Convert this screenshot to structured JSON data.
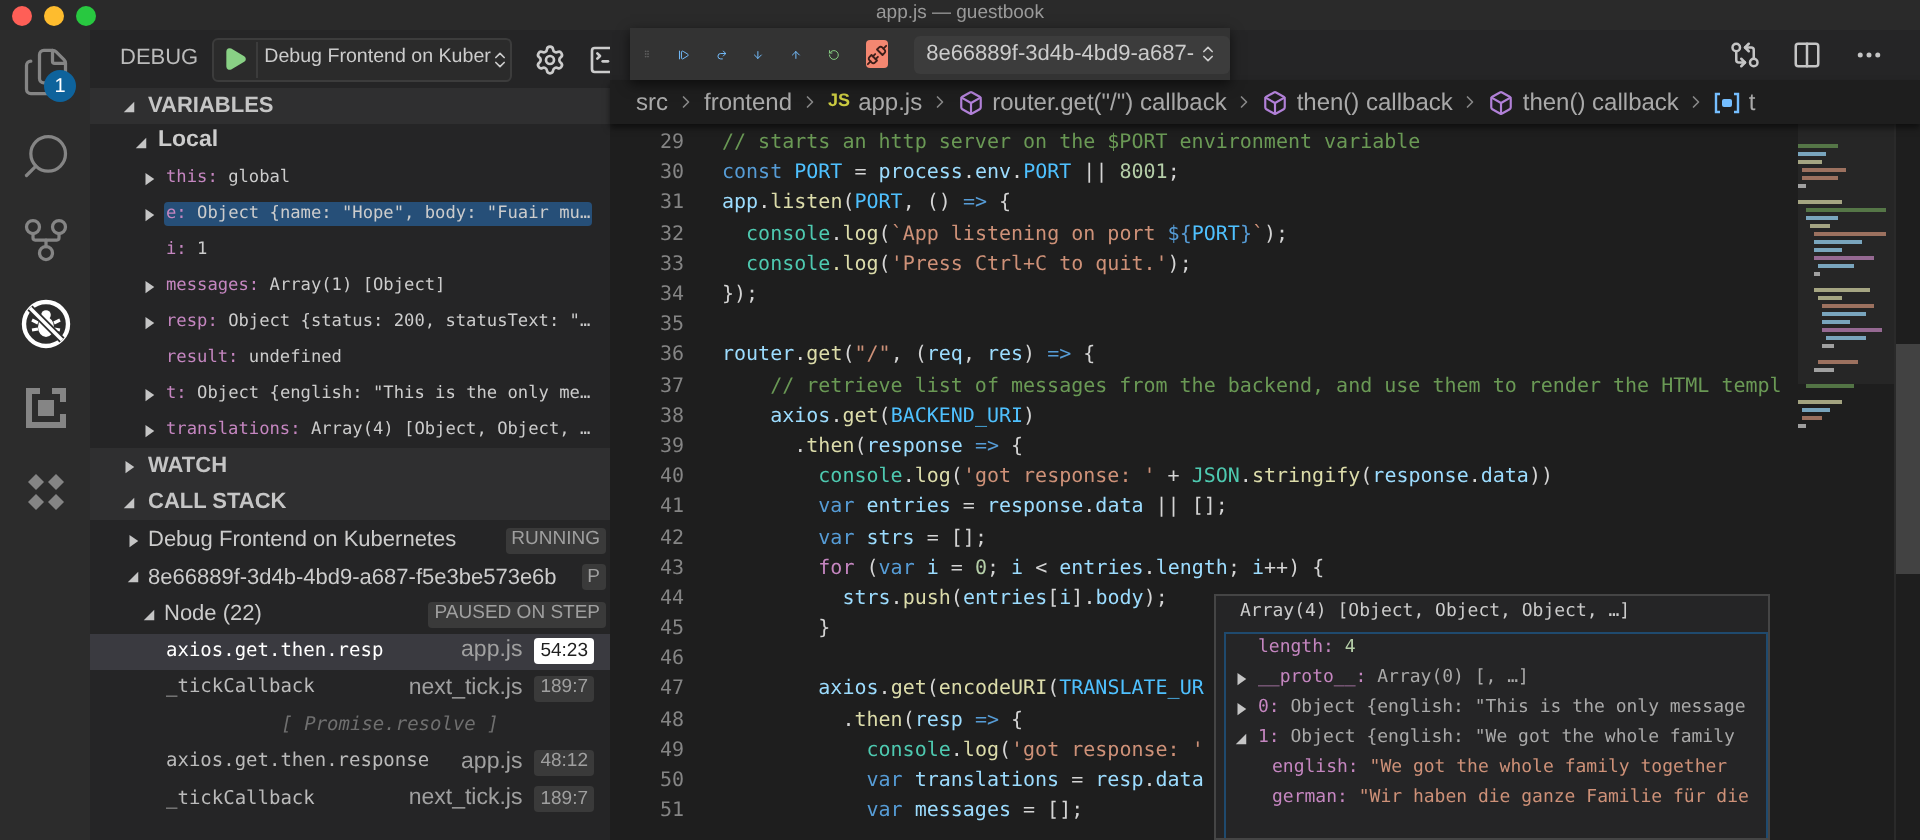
{
  "window": {
    "title": "app.js — guestbook"
  },
  "activity_bar": {
    "items": [
      {
        "kind": "files",
        "selected": false,
        "badge": "1"
      },
      {
        "kind": "search",
        "selected": false
      },
      {
        "kind": "source-control",
        "selected": false
      },
      {
        "kind": "debug",
        "selected": true
      },
      {
        "kind": "extensions",
        "selected": false
      },
      {
        "kind": "kubernetes",
        "selected": false
      }
    ]
  },
  "sidebar": {
    "title": "DEBUG",
    "configuration": "Debug Frontend on Kuber",
    "sections": [
      {
        "kind": "variables",
        "title": "VARIABLES",
        "expanded": true,
        "scopes": [
          {
            "name": "Local",
            "expanded": true,
            "children": [
              {
                "kind": "node",
                "name": "this:",
                "value": "global",
                "expanded": false,
                "selected": false
              },
              {
                "kind": "node",
                "name": "e:",
                "value": "Object {name: \"Hope\", body: \"Fuair mu…",
                "expanded": false,
                "selected": true
              },
              {
                "kind": "leaf",
                "name": "i:",
                "value": "1",
                "selected": false
              },
              {
                "kind": "node",
                "name": "messages:",
                "value": "Array(1) [Object]",
                "expanded": false,
                "selected": false
              },
              {
                "kind": "node",
                "name": "resp:",
                "value": "Object {status: 200, statusText: \"…",
                "expanded": false,
                "selected": false
              },
              {
                "kind": "leaf",
                "name": "result:",
                "value": "undefined",
                "selected": false
              },
              {
                "kind": "node",
                "name": "t:",
                "value": "Object {english: \"This is the only me…",
                "expanded": false,
                "selected": false
              },
              {
                "kind": "node",
                "name": "translations:",
                "value": "Array(4) [Object, Object, …",
                "expanded": false,
                "selected": false
              }
            ]
          }
        ]
      },
      {
        "kind": "watch",
        "title": "WATCH",
        "expanded": false
      },
      {
        "kind": "call-stack",
        "title": "CALL STACK",
        "expanded": true,
        "children": [
          {
            "kind": "session",
            "label": "Debug Frontend on Kubernetes",
            "badge": "RUNNING",
            "expanded": false
          },
          {
            "kind": "session",
            "label": "8e66889f-3d4b-4bd9-a687-f5e3be573e6b",
            "badge": "P",
            "expanded": true,
            "children": [
              {
                "kind": "thread",
                "label": "Node (22)",
                "badge": "PAUSED ON STEP",
                "expanded": true,
                "children": [
                  {
                    "kind": "frame",
                    "name": "axios.get.then.resp",
                    "file": "app.js",
                    "position": "54:23",
                    "selected": true
                  },
                  {
                    "kind": "frame",
                    "name": "_tickCallback",
                    "file": "next_tick.js",
                    "position": "189:7",
                    "selected": false
                  },
                  {
                    "kind": "label",
                    "name": "[ Promise.resolve ]"
                  },
                  {
                    "kind": "frame",
                    "name": "axios.get.then.response",
                    "file": "app.js",
                    "position": "48:12",
                    "selected": false
                  },
                  {
                    "kind": "frame",
                    "name": "_tickCallback",
                    "file": "next_tick.js",
                    "position": "189:7",
                    "selected": false
                  }
                ]
              }
            ]
          }
        ]
      }
    ]
  },
  "debug_toolbar": {
    "buttons": [
      {
        "kind": "continue"
      },
      {
        "kind": "step-over"
      },
      {
        "kind": "step-into"
      },
      {
        "kind": "step-out"
      },
      {
        "kind": "restart"
      },
      {
        "kind": "disconnect"
      }
    ],
    "thread": "8e66889f-3d4b-4bd9-a687-"
  },
  "breadcrumb": [
    {
      "kind": "folder",
      "label": "src"
    },
    {
      "kind": "folder",
      "label": "frontend"
    },
    {
      "kind": "file",
      "badge": "JS",
      "label": "app.js"
    },
    {
      "kind": "symbol",
      "label": "router.get(\"/\") callback"
    },
    {
      "kind": "symbol",
      "label": "then() callback"
    },
    {
      "kind": "symbol",
      "label": "then() callback"
    },
    {
      "kind": "variable",
      "label": "t"
    }
  ],
  "editor": {
    "lines": [
      {
        "number": "29",
        "tokens": [
          {
            "kind": "comment",
            "text": "// starts an http server on the $PORT environment variable"
          }
        ]
      },
      {
        "number": "30",
        "tokens": [
          {
            "kind": "kw",
            "text": "const "
          },
          {
            "kind": "const",
            "text": "PORT"
          },
          {
            "kind": "p",
            "text": " = "
          },
          {
            "kind": "var",
            "text": "process"
          },
          {
            "kind": "p",
            "text": "."
          },
          {
            "kind": "var",
            "text": "env"
          },
          {
            "kind": "p",
            "text": "."
          },
          {
            "kind": "const",
            "text": "PORT"
          },
          {
            "kind": "p",
            "text": " || "
          },
          {
            "kind": "num",
            "text": "8001"
          },
          {
            "kind": "p",
            "text": ";"
          }
        ]
      },
      {
        "number": "31",
        "tokens": [
          {
            "kind": "var",
            "text": "app"
          },
          {
            "kind": "p",
            "text": "."
          },
          {
            "kind": "fn",
            "text": "listen"
          },
          {
            "kind": "p",
            "text": "("
          },
          {
            "kind": "const",
            "text": "PORT"
          },
          {
            "kind": "p",
            "text": ", () "
          },
          {
            "kind": "kw",
            "text": "=>"
          },
          {
            "kind": "p",
            "text": " {"
          }
        ]
      },
      {
        "number": "32",
        "tokens": [
          {
            "kind": "type",
            "text": "  console"
          },
          {
            "kind": "p",
            "text": "."
          },
          {
            "kind": "fn",
            "text": "log"
          },
          {
            "kind": "p",
            "text": "("
          },
          {
            "kind": "str",
            "text": "`App listening on port "
          },
          {
            "kind": "kw",
            "text": "${"
          },
          {
            "kind": "const",
            "text": "PORT"
          },
          {
            "kind": "kw",
            "text": "}"
          },
          {
            "kind": "str",
            "text": "`"
          },
          {
            "kind": "p",
            "text": ");"
          }
        ]
      },
      {
        "number": "33",
        "tokens": [
          {
            "kind": "type",
            "text": "  console"
          },
          {
            "kind": "fn",
            "text": ".log"
          },
          {
            "kind": "p",
            "text": "("
          },
          {
            "kind": "str",
            "text": "'Press Ctrl+C to quit.'"
          },
          {
            "kind": "p",
            "text": ");"
          }
        ]
      },
      {
        "number": "34",
        "tokens": [
          {
            "kind": "p",
            "text": "});"
          }
        ]
      },
      {
        "number": "35"
      },
      {
        "number": "36",
        "tokens": [
          {
            "kind": "var",
            "text": "router"
          },
          {
            "kind": "p",
            "text": "."
          },
          {
            "kind": "fn",
            "text": "get"
          },
          {
            "kind": "p",
            "text": "("
          },
          {
            "kind": "str",
            "text": "\"/\""
          },
          {
            "kind": "p",
            "text": ", ("
          },
          {
            "kind": "var",
            "text": "req"
          },
          {
            "kind": "p",
            "text": ", "
          },
          {
            "kind": "var",
            "text": "res"
          },
          {
            "kind": "p",
            "text": ") "
          },
          {
            "kind": "kw",
            "text": "=>"
          },
          {
            "kind": "p",
            "text": " {"
          }
        ]
      },
      {
        "number": "37",
        "tokens": [
          {
            "kind": "comment",
            "text": "    // retrieve list of messages from the backend, and use them to render the HTML templ"
          }
        ]
      },
      {
        "number": "38",
        "tokens": [
          {
            "kind": "var",
            "text": "    axios"
          },
          {
            "kind": "p",
            "text": "."
          },
          {
            "kind": "fn",
            "text": "get"
          },
          {
            "kind": "p",
            "text": "("
          },
          {
            "kind": "const",
            "text": "BACKEND_URI"
          },
          {
            "kind": "p",
            "text": ")"
          }
        ]
      },
      {
        "number": "39",
        "tokens": [
          {
            "kind": "p",
            "text": "      ."
          },
          {
            "kind": "fn",
            "text": "then"
          },
          {
            "kind": "p",
            "text": "("
          },
          {
            "kind": "var",
            "text": "response "
          },
          {
            "kind": "kw",
            "text": "=>"
          },
          {
            "kind": "p",
            "text": " {"
          }
        ]
      },
      {
        "number": "40",
        "tokens": [
          {
            "kind": "type",
            "text": "        console"
          },
          {
            "kind": "p",
            "text": "."
          },
          {
            "kind": "fn",
            "text": "log"
          },
          {
            "kind": "p",
            "text": "("
          },
          {
            "kind": "str",
            "text": "'got response: '"
          },
          {
            "kind": "p",
            "text": " + "
          },
          {
            "kind": "type",
            "text": "JSON"
          },
          {
            "kind": "p",
            "text": "."
          },
          {
            "kind": "fn",
            "text": "stringify"
          },
          {
            "kind": "p",
            "text": "("
          },
          {
            "kind": "var",
            "text": "response"
          },
          {
            "kind": "p",
            "text": "."
          },
          {
            "kind": "var",
            "text": "data"
          },
          {
            "kind": "p",
            "text": "))"
          }
        ]
      },
      {
        "number": "41",
        "tokens": [
          {
            "kind": "kw",
            "text": "        var "
          },
          {
            "kind": "var",
            "text": "entries"
          },
          {
            "kind": "p",
            "text": " = "
          },
          {
            "kind": "var",
            "text": "response"
          },
          {
            "kind": "p",
            "text": "."
          },
          {
            "kind": "var",
            "text": "data"
          },
          {
            "kind": "p",
            "text": " || [];"
          }
        ]
      },
      {
        "number": "42",
        "tokens": [
          {
            "kind": "kw",
            "text": "        var "
          },
          {
            "kind": "var",
            "text": "strs"
          },
          {
            "kind": "p",
            "text": " = [];"
          }
        ]
      },
      {
        "number": "43",
        "tokens": [
          {
            "kind": "ctrl",
            "text": "        for"
          },
          {
            "kind": "p",
            "text": " ("
          },
          {
            "kind": "kw",
            "text": "var "
          },
          {
            "kind": "var",
            "text": "i"
          },
          {
            "kind": "p",
            "text": " = "
          },
          {
            "kind": "num",
            "text": "0"
          },
          {
            "kind": "p",
            "text": "; "
          },
          {
            "kind": "var",
            "text": "i"
          },
          {
            "kind": "p",
            "text": " < "
          },
          {
            "kind": "var",
            "text": "entries"
          },
          {
            "kind": "p",
            "text": "."
          },
          {
            "kind": "var",
            "text": "length"
          },
          {
            "kind": "p",
            "text": "; "
          },
          {
            "kind": "var",
            "text": "i"
          },
          {
            "kind": "p",
            "text": "++) {"
          }
        ]
      },
      {
        "number": "44",
        "tokens": [
          {
            "kind": "var",
            "text": "          strs"
          },
          {
            "kind": "p",
            "text": "."
          },
          {
            "kind": "fn",
            "text": "push"
          },
          {
            "kind": "p",
            "text": "("
          },
          {
            "kind": "var",
            "text": "entries"
          },
          {
            "kind": "p",
            "text": "["
          },
          {
            "kind": "var",
            "text": "i"
          },
          {
            "kind": "p",
            "text": "]."
          },
          {
            "kind": "var",
            "text": "body"
          },
          {
            "kind": "p",
            "text": ");"
          }
        ]
      },
      {
        "number": "45",
        "tokens": [
          {
            "kind": "p",
            "text": "        }"
          }
        ]
      },
      {
        "number": "46"
      },
      {
        "number": "47",
        "tokens": [
          {
            "kind": "var",
            "text": "        axios"
          },
          {
            "kind": "p",
            "text": "."
          },
          {
            "kind": "fn",
            "text": "get"
          },
          {
            "kind": "p",
            "text": "("
          },
          {
            "kind": "fn",
            "text": "encodeURI"
          },
          {
            "kind": "p",
            "text": "("
          },
          {
            "kind": "const",
            "text": "TRANSLATE_UR"
          }
        ]
      },
      {
        "number": "48",
        "tokens": [
          {
            "kind": "p",
            "text": "          ."
          },
          {
            "kind": "fn",
            "text": "then"
          },
          {
            "kind": "p",
            "text": "("
          },
          {
            "kind": "var",
            "text": "resp "
          },
          {
            "kind": "kw",
            "text": "=>"
          },
          {
            "kind": "p",
            "text": " {"
          }
        ]
      },
      {
        "number": "49",
        "tokens": [
          {
            "kind": "type",
            "text": "            console"
          },
          {
            "kind": "p",
            "text": "."
          },
          {
            "kind": "fn",
            "text": "log"
          },
          {
            "kind": "p",
            "text": "("
          },
          {
            "kind": "str",
            "text": "'got response: '"
          }
        ]
      },
      {
        "number": "50",
        "tokens": [
          {
            "kind": "kw",
            "text": "            var "
          },
          {
            "kind": "var",
            "text": "translations"
          },
          {
            "kind": "p",
            "text": " = "
          },
          {
            "kind": "var",
            "text": "resp"
          },
          {
            "kind": "p",
            "text": "."
          },
          {
            "kind": "var",
            "text": "data"
          }
        ]
      },
      {
        "number": "51",
        "tokens": [
          {
            "kind": "kw",
            "text": "            var "
          },
          {
            "kind": "var",
            "text": "messages"
          },
          {
            "kind": "p",
            "text": " = [];"
          }
        ]
      }
    ]
  },
  "hover": {
    "title": "Array(4) [Object, Object, Object, …]",
    "items": [
      {
        "kind": "number",
        "name": "length:",
        "value": "4"
      },
      {
        "kind": "object",
        "name": "__proto__:",
        "value": "Array(0) [, …]",
        "expanded": false
      },
      {
        "kind": "object",
        "name": "0:",
        "value": "Object {english: \"This is the only message",
        "expanded": false
      },
      {
        "kind": "object",
        "name": "1:",
        "value": "Object {english: \"We got the whole family",
        "expanded": true,
        "children": [
          {
            "kind": "string",
            "name": "english:",
            "value": "\"We got the whole family together"
          },
          {
            "kind": "string",
            "name": "german:",
            "value": "\"Wir haben die ganze Familie für die"
          }
        ]
      }
    ]
  }
}
